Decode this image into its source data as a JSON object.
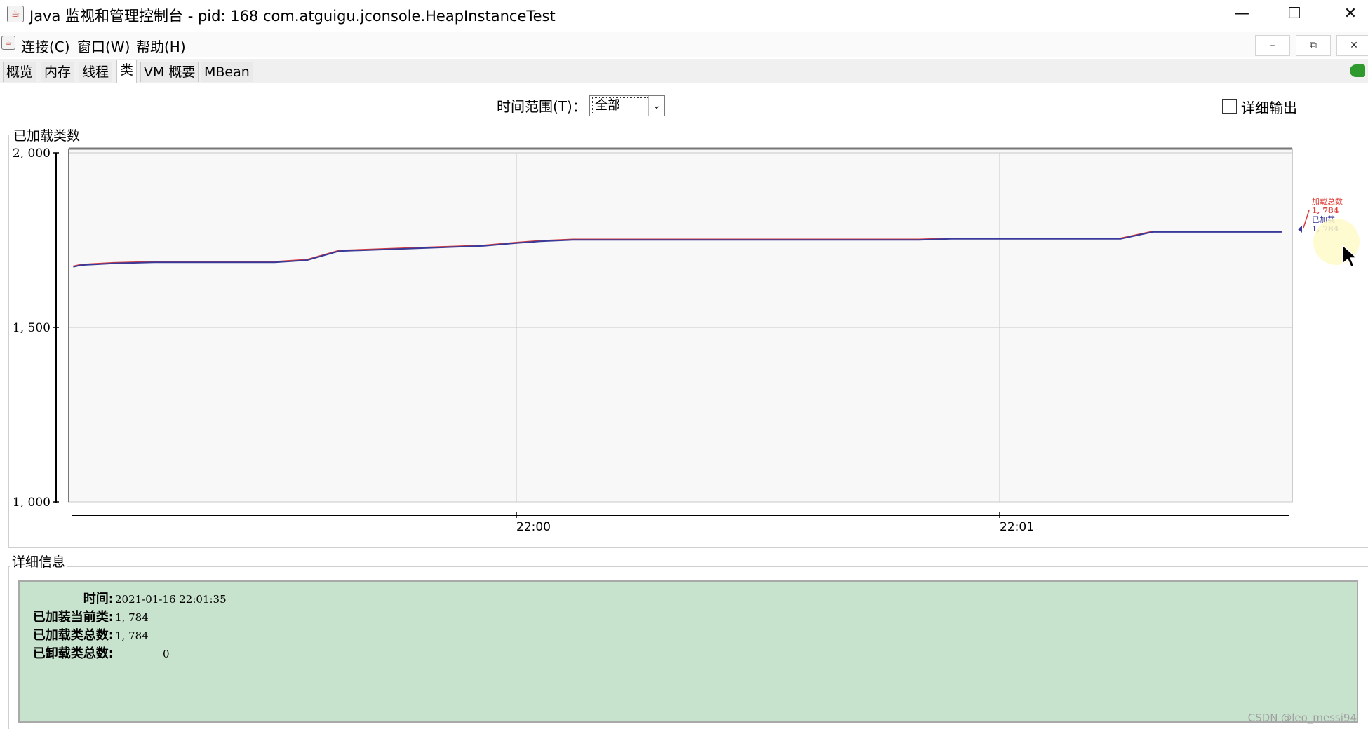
{
  "window": {
    "title": "Java 监视和管理控制台 - pid: 168 com.atguigu.jconsole.HeapInstanceTest",
    "minimize_icon": "minimize-icon",
    "maximize_icon": "maximize-icon",
    "close_icon": "close-icon"
  },
  "menu": {
    "items": [
      "连接(C)",
      "窗口(W)",
      "帮助(H)"
    ]
  },
  "inner_window_buttons": [
    "minimize-icon",
    "restore-icon",
    "close-icon"
  ],
  "tabs": {
    "items": [
      "概览",
      "内存",
      "线程",
      "类",
      "VM 概要",
      "MBean"
    ],
    "active": "类"
  },
  "toolbar": {
    "range_label": "时间范围(T)：",
    "range_value": "全部",
    "verbose_label": "详细输出",
    "verbose_checked": false
  },
  "chart": {
    "section_title": "已加载类数",
    "legend": {
      "total_label": "加载总数",
      "total_value": "1, 784",
      "loaded_label": "已加载",
      "loaded_value": "1, 784",
      "total_color": "#e0403a",
      "loaded_color": "#3a3a9a"
    }
  },
  "chart_data": {
    "type": "line",
    "title": "已加载类数",
    "x_tick_labels": [
      "22:00",
      "22:01"
    ],
    "y_tick_labels": [
      "2, 000",
      "1, 500",
      "1, 000"
    ],
    "y_ticks": [
      2000,
      1500,
      1000
    ],
    "ylim": [
      1000,
      2000
    ],
    "x": [
      "21:59:05",
      "21:59:06",
      "21:59:10",
      "21:59:15",
      "21:59:30",
      "21:59:34",
      "21:59:38",
      "21:59:56",
      "22:00:00",
      "22:00:03",
      "22:00:07",
      "22:00:50",
      "22:00:54",
      "22:01:15",
      "22:01:19",
      "22:01:35"
    ],
    "series": [
      {
        "name": "加载总数",
        "color": "#d63a3a",
        "values": [
          1675,
          1680,
          1685,
          1688,
          1688,
          1694,
          1720,
          1735,
          1743,
          1748,
          1752,
          1752,
          1755,
          1755,
          1775,
          1775
        ]
      },
      {
        "name": "已加载",
        "color": "#3a3a9a",
        "values": [
          1675,
          1680,
          1685,
          1688,
          1688,
          1694,
          1720,
          1735,
          1743,
          1748,
          1752,
          1752,
          1755,
          1755,
          1775,
          1775
        ]
      }
    ],
    "grid": true
  },
  "details": {
    "section_title": "详细信息",
    "rows": [
      {
        "key": "时间:",
        "value": "2021-01-16 22:01:35"
      },
      {
        "key": "已加装当前类:",
        "value": "1, 784"
      },
      {
        "key": "已加载类总数:",
        "value": "1, 784"
      },
      {
        "key": "已卸载类总数:",
        "value": "0"
      }
    ]
  },
  "watermark": "CSDN @leo_messi94"
}
